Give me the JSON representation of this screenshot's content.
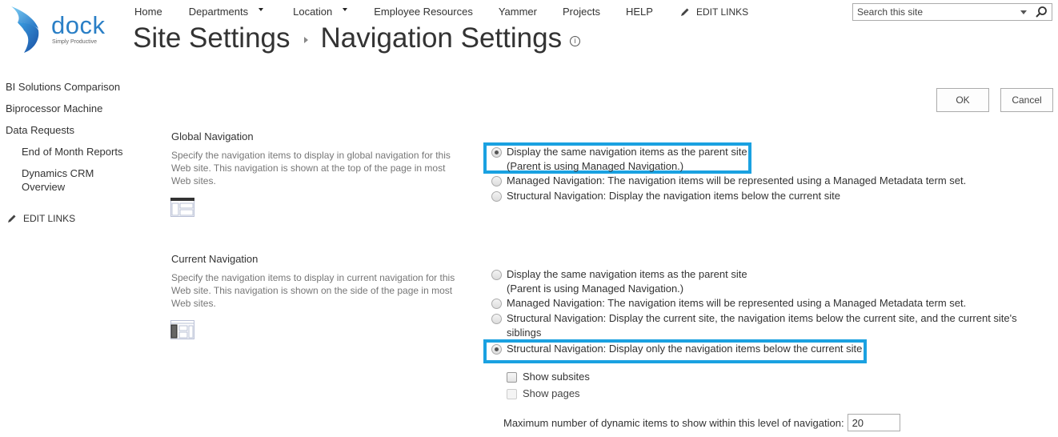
{
  "brand": {
    "name": "dock",
    "tagline": "Simply Productive",
    "color": "#2a7fc6"
  },
  "topnav": {
    "items": [
      {
        "label": "Home",
        "has_dropdown": false
      },
      {
        "label": "Departments",
        "has_dropdown": true
      },
      {
        "label": "Location",
        "has_dropdown": true
      },
      {
        "label": "Employee Resources",
        "has_dropdown": false
      },
      {
        "label": "Yammer",
        "has_dropdown": false
      },
      {
        "label": "Projects",
        "has_dropdown": false
      },
      {
        "label": "HELP",
        "has_dropdown": false
      }
    ],
    "edit_links": "EDIT LINKS"
  },
  "search": {
    "placeholder": "Search this site",
    "value": ""
  },
  "title": {
    "parent": "Site Settings",
    "current": "Navigation Settings",
    "info_icon": "i"
  },
  "leftnav": {
    "items": [
      {
        "label": "BI Solutions Comparison",
        "level": 0
      },
      {
        "label": "Biprocessor Machine",
        "level": 0
      },
      {
        "label": "Data Requests",
        "level": 0
      },
      {
        "label": "End of Month Reports",
        "level": 1
      },
      {
        "label": "Dynamics CRM Overview",
        "level": 1
      }
    ],
    "edit_links": "EDIT LINKS"
  },
  "actions": {
    "ok": "OK",
    "cancel": "Cancel"
  },
  "global_nav": {
    "title": "Global Navigation",
    "description": "Specify the navigation items to display in global navigation for this Web site. This navigation is shown at the top of the page in most Web sites.",
    "options": [
      {
        "line1": "Display the same navigation items as the parent site",
        "line2": "(Parent is using Managed Navigation.)",
        "selected": true
      },
      {
        "line1": "Managed Navigation: The navigation items will be represented using a Managed Metadata term set.",
        "selected": false
      },
      {
        "line1": "Structural Navigation: Display the navigation items below the current site",
        "selected": false
      }
    ],
    "highlight_color": "#1aa1e1"
  },
  "current_nav": {
    "title": "Current Navigation",
    "description": "Specify the navigation items to display in current navigation for this Web site. This navigation is shown on the side of the page in most Web sites.",
    "options": [
      {
        "line1": "Display the same navigation items as the parent site",
        "line2": "(Parent is using Managed Navigation.)",
        "selected": false
      },
      {
        "line1": "Managed Navigation: The navigation items will be represented using a Managed Metadata term set.",
        "selected": false
      },
      {
        "line1": "Structural Navigation: Display the current site, the navigation items below the current site, and the current site's",
        "line2": "siblings",
        "selected": false
      },
      {
        "line1": "Structural Navigation: Display only the navigation items below the current site",
        "selected": true
      }
    ],
    "show_subsites": {
      "label": "Show subsites",
      "checked": false,
      "enabled": true
    },
    "show_pages": {
      "label": "Show pages",
      "checked": false,
      "enabled": false
    },
    "max_items_label": "Maximum number of dynamic items to show within this level of navigation:",
    "max_items_value": "20"
  }
}
